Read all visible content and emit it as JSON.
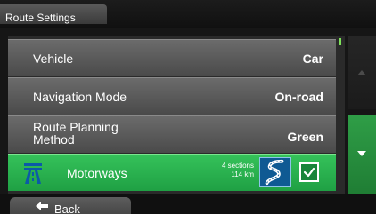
{
  "header": {
    "title": "Route Settings"
  },
  "settings": {
    "vehicle": {
      "label": "Vehicle",
      "value": "Car"
    },
    "navigation_mode": {
      "label": "Navigation Mode",
      "value": "On-road"
    },
    "route_planning_method": {
      "label": "Route Planning Method",
      "value": "Green"
    },
    "motorways": {
      "label": "Motorways",
      "sections": "4 sections",
      "distance": "114 km",
      "checked": true
    }
  },
  "footer": {
    "back_label": "Back"
  },
  "colors": {
    "accent": "#2fbf59",
    "row": "#5a5a5a",
    "background": "#161616"
  },
  "icons": {
    "motorway": "motorway-sign-icon",
    "road": "winding-road-icon",
    "check": "checkmark-icon",
    "scroll_up": "scroll-up-arrow-icon",
    "scroll_down": "scroll-down-arrow-icon",
    "back": "back-arrow-icon"
  }
}
